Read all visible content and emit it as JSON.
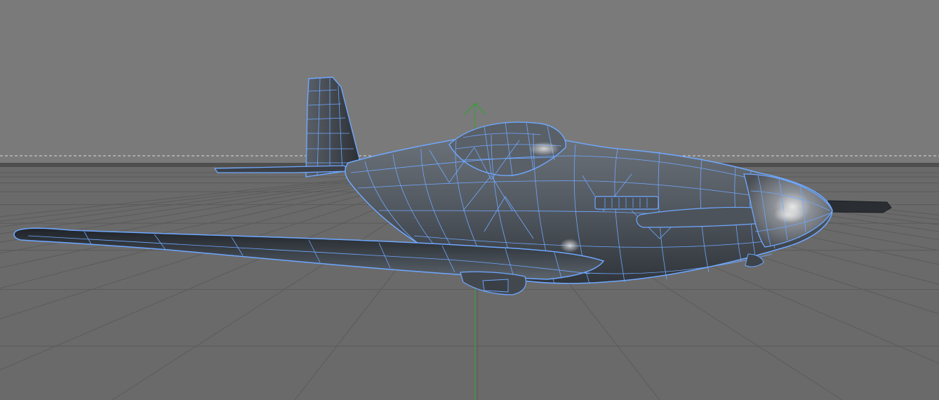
{
  "viewport": {
    "view": "perspective",
    "background_color": "#7a7a7a",
    "floor_color": "#6a6a6a",
    "grid_color": "#5b5b5b",
    "horizon_line_color": "#d8d8d8",
    "selection_wire_color": "#6fa8ff",
    "y_axis_color": "#3f9a3f",
    "icons": [
      "world-y-axis-arrow-icon"
    ]
  },
  "scene": {
    "object": "aircraft-model",
    "display_mode": "shaded-with-wireframe",
    "selected": true
  }
}
